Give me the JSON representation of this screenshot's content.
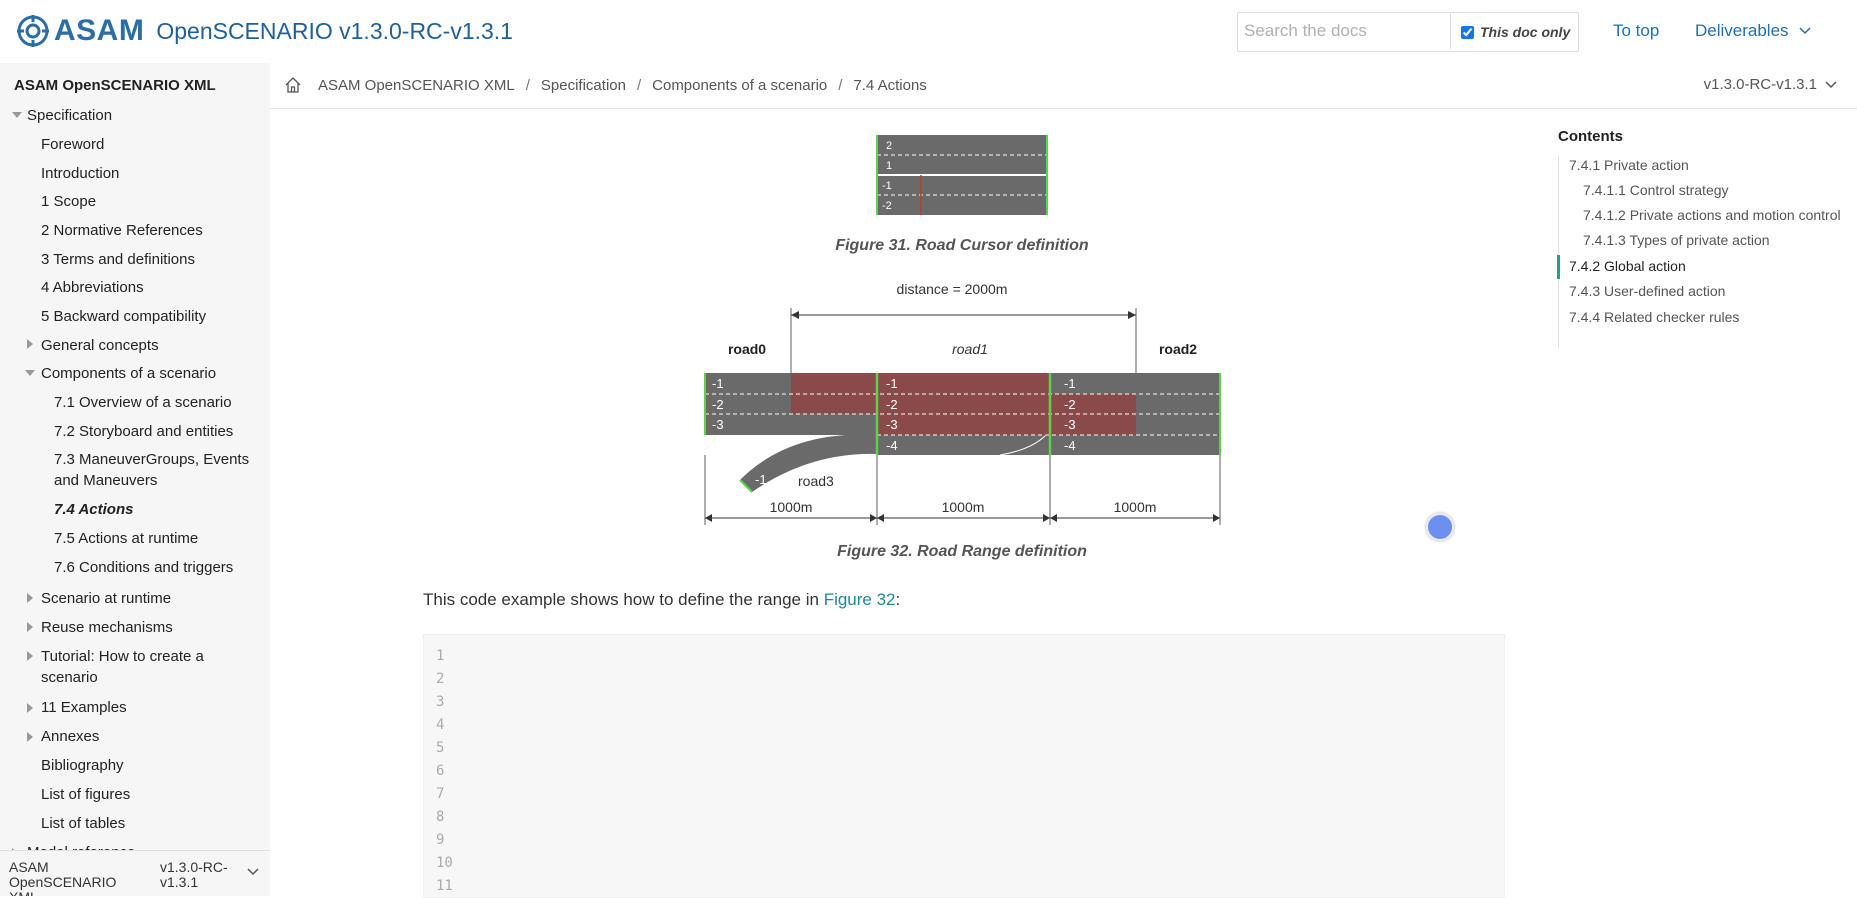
{
  "header": {
    "logo_text": "ASAM",
    "site_title": "OpenSCENARIO v1.3.0-RC-v1.3.1",
    "search_placeholder": "Search the docs",
    "doc_only_label": "This doc only",
    "to_top": "To top",
    "deliverables": "Deliverables"
  },
  "sidebar": {
    "root": "ASAM OpenSCENARIO XML",
    "items": {
      "specification": "Specification",
      "foreword": "Foreword",
      "introduction": "Introduction",
      "scope": "1 Scope",
      "normative": "2 Normative References",
      "terms": "3 Terms and definitions",
      "abbrev": "4 Abbreviations",
      "backward": "5 Backward compatibility",
      "general": "General concepts",
      "components": "Components of a scenario",
      "s71": "7.1 Overview of a scenario",
      "s72": "7.2 Storyboard and entities",
      "s73": "7.3 ManeuverGroups, Events and Maneuvers",
      "s74": "7.4 Actions",
      "s75": "7.5 Actions at runtime",
      "s76": "7.6 Conditions and triggers",
      "runtime": "Scenario at runtime",
      "reuse": "Reuse mechanisms",
      "tutorial": "Tutorial: How to create a scenario",
      "examples": "11 Examples",
      "annexes": "Annexes",
      "bibliography": "Bibliography",
      "figures": "List of figures",
      "tables": "List of tables",
      "model": "Model reference"
    },
    "footer_component": "ASAM OpenSCENARIO XML",
    "footer_version": "v1.3.0-RC-v1.3.1"
  },
  "breadcrumb": {
    "c1": "ASAM OpenSCENARIO XML",
    "c2": "Specification",
    "c3": "Components of a scenario",
    "c4": "7.4 Actions",
    "version": "v1.3.0-RC-v1.3.1"
  },
  "main": {
    "fig31": {
      "caption": "Figure 31. Road Cursor definition",
      "lanes": [
        "2",
        "1",
        "-1",
        "-2"
      ]
    },
    "fig32": {
      "caption": "Figure 32. Road Range definition",
      "distance": "distance = 2000m",
      "road0": "road0",
      "road1": "road1",
      "road2": "road2",
      "road3": "road3",
      "lanes": [
        "-1",
        "-2",
        "-3",
        "-4"
      ],
      "seg": "1000m"
    },
    "para_text": "This code example shows how to define the range in ",
    "para_link": "Figure 32",
    "para_end": ":",
    "line_numbers": [
      "1",
      "2",
      "3",
      "4",
      "5",
      "6",
      "7",
      "8",
      "9",
      "10",
      "11"
    ]
  },
  "toc": {
    "title": "Contents",
    "items": {
      "t741": "7.4.1 Private action",
      "t7411": "7.4.1.1 Control strategy",
      "t7412": "7.4.1.2 Private actions and motion control",
      "t7413": "7.4.1.3 Types of private action",
      "t742": "7.4.2 Global action",
      "t743": "7.4.3 User-defined action",
      "t744": "7.4.4 Related checker rules"
    }
  },
  "colors": {
    "accent": "#1aa198",
    "link": "#1f6fb5",
    "lane_highlight": "#8b4a4a",
    "road": "#6a6a6a"
  }
}
